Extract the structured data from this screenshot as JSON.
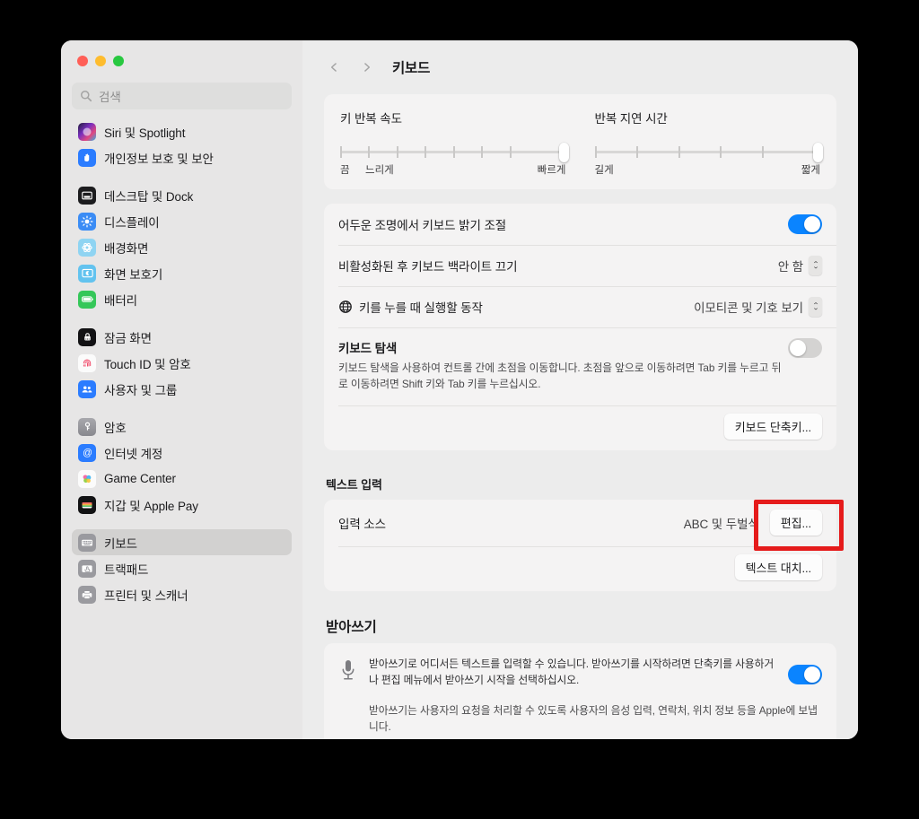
{
  "window": {
    "title": "키보드",
    "traffic_lights": [
      "close",
      "minimize",
      "zoom"
    ]
  },
  "sidebar": {
    "search_placeholder": "검색",
    "groups": [
      {
        "items": [
          {
            "label": "Siri 및 Spotlight",
            "icon": "siri-icon",
            "selected": false
          },
          {
            "label": "개인정보 보호 및 보안",
            "icon": "privacy-hand-icon",
            "selected": false
          }
        ]
      },
      {
        "items": [
          {
            "label": "데스크탑 및 Dock",
            "icon": "desktop-dock-icon",
            "selected": false
          },
          {
            "label": "디스플레이",
            "icon": "display-brightness-icon",
            "selected": false
          },
          {
            "label": "배경화면",
            "icon": "wallpaper-icon",
            "selected": false
          },
          {
            "label": "화면 보호기",
            "icon": "screensaver-icon",
            "selected": false
          },
          {
            "label": "배터리",
            "icon": "battery-icon",
            "selected": false
          }
        ]
      },
      {
        "items": [
          {
            "label": "잠금 화면",
            "icon": "lock-screen-icon",
            "selected": false
          },
          {
            "label": "Touch ID 및 암호",
            "icon": "touch-id-icon",
            "selected": false
          },
          {
            "label": "사용자 및 그룹",
            "icon": "users-groups-icon",
            "selected": false
          }
        ]
      },
      {
        "items": [
          {
            "label": "암호",
            "icon": "passwords-key-icon",
            "selected": false
          },
          {
            "label": "인터넷 계정",
            "icon": "internet-accounts-icon",
            "selected": false
          },
          {
            "label": "Game Center",
            "icon": "game-center-icon",
            "selected": false
          },
          {
            "label": "지갑 및 Apple Pay",
            "icon": "wallet-icon",
            "selected": false
          }
        ]
      },
      {
        "items": [
          {
            "label": "키보드",
            "icon": "keyboard-icon",
            "selected": true
          },
          {
            "label": "트랙패드",
            "icon": "trackpad-icon",
            "selected": false
          },
          {
            "label": "프린터 및 스캐너",
            "icon": "printer-scanner-icon",
            "selected": false
          }
        ]
      }
    ]
  },
  "toolbar": {
    "back": "‹",
    "forward": "›",
    "title": "키보드"
  },
  "sliders": {
    "key_repeat": {
      "title": "키 반복 속도",
      "label_off": "끔",
      "label_min": "느리게",
      "label_max": "빠르게",
      "ticks": 7,
      "value_percent": 100
    },
    "delay_until_repeat": {
      "title": "반복 지연 시간",
      "label_min": "길게",
      "label_max": "짧게",
      "ticks": 5,
      "value_percent": 100
    }
  },
  "keyboard_card": {
    "adjust_brightness": {
      "label": "어두운 조명에서 키보드 밝기 조절",
      "toggle_on": true
    },
    "turn_backlight_off": {
      "label": "비활성화된 후 키보드 백라이트 끄기",
      "value": "안 함"
    },
    "globe_key_action": {
      "label": "키를 누를 때 실행할 동작",
      "icon": "globe-icon",
      "value": "이모티콘 및 기호 보기"
    },
    "keyboard_navigation": {
      "title": "키보드 탐색",
      "description": "키보드 탐색을 사용하여 컨트롤 간에 초점을 이동합니다. 초점을 앞으로 이동하려면 Tab 키를 누르고 뒤로 이동하려면 Shift 키와 Tab 키를 누르십시오.",
      "toggle_on": false
    },
    "shortcuts_button": "키보드 단축키..."
  },
  "text_input": {
    "section_title": "텍스트 입력",
    "input_sources": {
      "label": "입력 소스",
      "value": "ABC 및 두벌식",
      "edit_button": "편집..."
    },
    "text_replacements_button": "텍스트 대치..."
  },
  "dictation": {
    "section_title": "받아쓰기",
    "icon": "microphone-icon",
    "description": "받아쓰기로 어디서든 텍스트를 입력할 수 있습니다. 받아쓰기를 시작하려면 단축키를 사용하거나 편집 메뉴에서 받아쓰기 시작을 선택하십시오.",
    "privacy_note": "받아쓰기는 사용자의 요청을 처리할 수 있도록 사용자의 음성 입력, 연락처, 위치 정보 등을 Apple에 보냅니다.",
    "toggle_on": true
  },
  "annotation": {
    "type": "highlight-rectangle",
    "color": "#e51b1b",
    "targets": "편집..."
  },
  "colors": {
    "accent_blue": "#0a84ff",
    "window_bg": "#ececec",
    "sidebar_bg": "#e7e6e6",
    "card_bg": "#f4f3f3",
    "annotation_red": "#e51b1b"
  }
}
